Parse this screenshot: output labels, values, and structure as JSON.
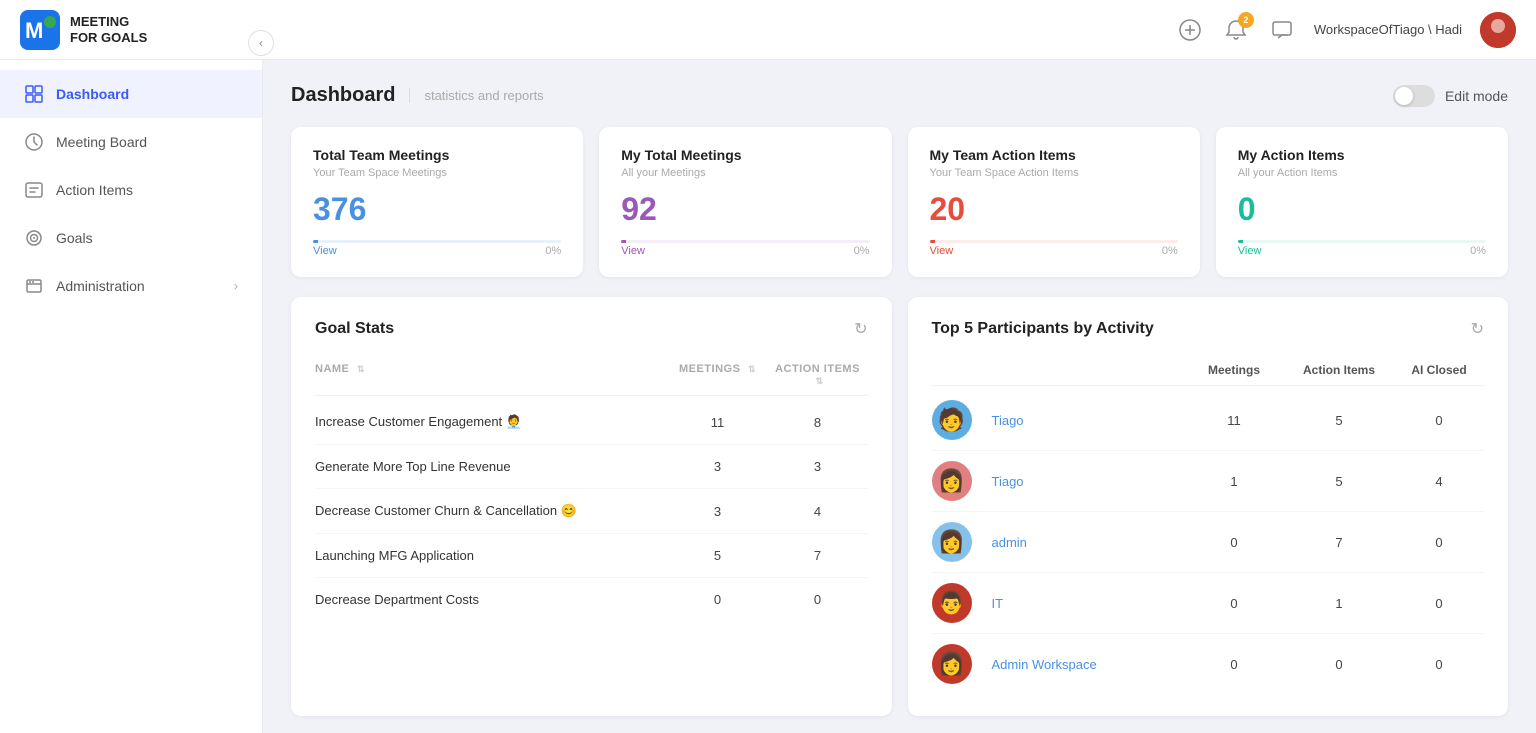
{
  "app": {
    "logo_text_line1": "MEETING",
    "logo_text_line2": "FOR GOALS"
  },
  "header": {
    "notification_count": "2",
    "workspace_label": "WorkspaceOfTiago \\ Hadi"
  },
  "sidebar": {
    "items": [
      {
        "id": "dashboard",
        "label": "Dashboard",
        "active": true
      },
      {
        "id": "meeting-board",
        "label": "Meeting Board",
        "active": false
      },
      {
        "id": "action-items",
        "label": "Action Items",
        "active": false
      },
      {
        "id": "goals",
        "label": "Goals",
        "active": false
      },
      {
        "id": "administration",
        "label": "Administration",
        "active": false,
        "has_chevron": true
      }
    ]
  },
  "page": {
    "title": "Dashboard",
    "subtitle": "statistics and reports",
    "edit_mode_label": "Edit mode"
  },
  "stat_cards": [
    {
      "title": "Total Team Meetings",
      "subtitle": "Your Team Space Meetings",
      "value": "376",
      "color": "blue",
      "view_label": "View",
      "pct": "0%",
      "bar_class": "blue-bar"
    },
    {
      "title": "My Total Meetings",
      "subtitle": "All your Meetings",
      "value": "92",
      "color": "purple",
      "view_label": "View",
      "pct": "0%",
      "bar_class": "purple-bar"
    },
    {
      "title": "My Team Action Items",
      "subtitle": "Your Team Space Action Items",
      "value": "20",
      "color": "red",
      "view_label": "View",
      "pct": "0%",
      "bar_class": "red-bar"
    },
    {
      "title": "My Action Items",
      "subtitle": "All your Action Items",
      "value": "0",
      "color": "teal",
      "view_label": "View",
      "pct": "0%",
      "bar_class": "teal-bar"
    }
  ],
  "goal_stats": {
    "title": "Goal Stats",
    "columns": [
      {
        "label": "NAME",
        "key": "name"
      },
      {
        "label": "MEETINGS",
        "key": "meetings"
      },
      {
        "label": "ACTION ITEMS",
        "key": "action_items"
      }
    ],
    "rows": [
      {
        "name": "Increase Customer Engagement 🧑‍💼",
        "meetings": "11",
        "action_items": "8"
      },
      {
        "name": "Generate More Top Line Revenue",
        "meetings": "3",
        "action_items": "3"
      },
      {
        "name": "Decrease Customer Churn & Cancellation 😊",
        "meetings": "3",
        "action_items": "4"
      },
      {
        "name": "Launching MFG Application",
        "meetings": "5",
        "action_items": "7"
      },
      {
        "name": "Decrease Department Costs",
        "meetings": "0",
        "action_items": "0"
      }
    ]
  },
  "top_participants": {
    "title": "Top 5 Participants by Activity",
    "columns": [
      {
        "label": ""
      },
      {
        "label": ""
      },
      {
        "label": "Meetings"
      },
      {
        "label": "Action Items"
      },
      {
        "label": "AI Closed"
      }
    ],
    "rows": [
      {
        "name": "Tiago",
        "meetings": "11",
        "action_items": "5",
        "ai_closed": "0",
        "avatar": "🧑",
        "avatar_bg": "#5dade2"
      },
      {
        "name": "Tiago",
        "meetings": "1",
        "action_items": "5",
        "ai_closed": "4",
        "avatar": "👩",
        "avatar_bg": "#e08080"
      },
      {
        "name": "admin",
        "meetings": "0",
        "action_items": "7",
        "ai_closed": "0",
        "avatar": "👩‍💼",
        "avatar_bg": "#85c1e9"
      },
      {
        "name": "IT",
        "meetings": "0",
        "action_items": "1",
        "ai_closed": "0",
        "avatar": "👨‍🦱",
        "avatar_bg": "#e74c3c"
      },
      {
        "name": "Admin Workspace",
        "meetings": "0",
        "action_items": "0",
        "ai_closed": "0",
        "avatar": "👩‍🦰",
        "avatar_bg": "#e74c3c"
      }
    ]
  }
}
